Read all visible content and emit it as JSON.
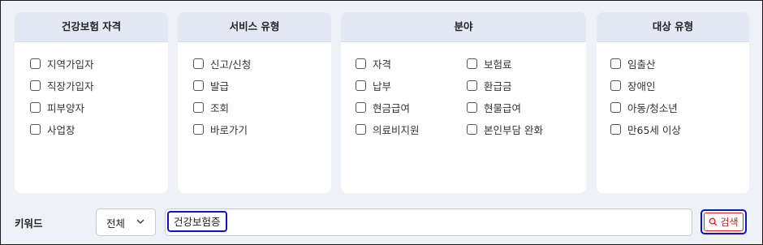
{
  "filters": {
    "eligibility": {
      "header": "건강보험 자격",
      "options": [
        "지역가입자",
        "직장가입자",
        "피부양자",
        "사업장"
      ]
    },
    "service_type": {
      "header": "서비스 유형",
      "options": [
        "신고/신청",
        "발급",
        "조회",
        "바로가기"
      ]
    },
    "field": {
      "header": "분야",
      "options": [
        "자격",
        "보험료",
        "납부",
        "환급금",
        "현금급여",
        "현물급여",
        "의료비지원",
        "본인부담 완화"
      ]
    },
    "target_type": {
      "header": "대상 유형",
      "options": [
        "임출산",
        "장애인",
        "아동/청소년",
        "만65세 이상"
      ]
    }
  },
  "keyword": {
    "label": "키워드",
    "scope_select": "전체",
    "input_value": "건강보험증",
    "search_label": "검색"
  },
  "colors": {
    "panel_header_bg": "#e3e8f5",
    "page_bg": "#eef1f6",
    "focus_outline": "#1010c8",
    "search_accent": "#e02020"
  },
  "icons": {
    "select": "chevron-down-icon",
    "search": "search-icon"
  }
}
